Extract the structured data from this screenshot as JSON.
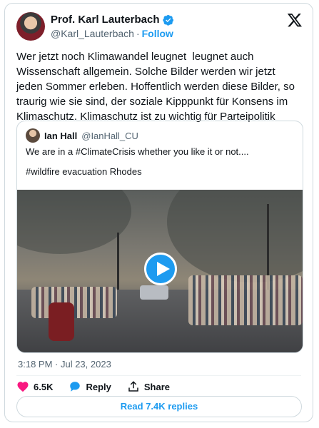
{
  "author": {
    "display_name": "Prof. Karl Lauterbach",
    "handle": "@Karl_Lauterbach",
    "separator": "·",
    "follow_label": "Follow"
  },
  "tweet": {
    "text": "Wer jetzt noch Klimawandel leugnet  leugnet auch Wissenschaft allgemein. Solche Bilder werden wir jetzt jeden Sommer erleben. Hoffentlich werden diese Bilder, so traurig wie sie sind, der soziale Kipppunkt für Konsens im Klimaschutz. Klimaschutz ist zu wichtig für Parteipolitik",
    "timestamp": "3:18 PM · Jul 23, 2023"
  },
  "quote": {
    "display_name": "Ian Hall",
    "handle": "@IanHall_CU",
    "text": "We are in a #ClimateCrisis whether you like it or not....",
    "hashtag_line": "#wildfire evacuation Rhodes"
  },
  "actions": {
    "like_count": "6.5K",
    "reply_label": "Reply",
    "share_label": "Share",
    "read_replies_label": "Read 7.4K replies"
  },
  "colors": {
    "accent": "#1d9bf0",
    "like": "#f91880",
    "muted": "#536471",
    "text": "#0f1419",
    "border": "#cfd9de"
  },
  "icons": [
    "verified-badge-icon",
    "x-logo-icon",
    "play-icon",
    "heart-icon",
    "reply-bubble-icon",
    "share-icon"
  ]
}
